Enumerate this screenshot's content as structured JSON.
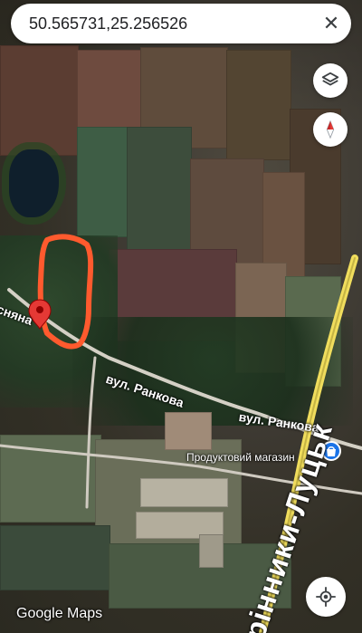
{
  "search": {
    "query": "50.565731,25.256526"
  },
  "map": {
    "road_label_primary": "вул. Ранкова",
    "road_label_secondary": "вул. Ранкова",
    "left_road_fragment": "сняна",
    "poi_label": "Продуктовий магазин",
    "major_road": "Хрінники-Луцьк",
    "attribution": "Google Maps"
  },
  "icons": {
    "close": "close-icon",
    "layers": "layers-icon",
    "compass": "compass-icon",
    "locate": "my-location-icon",
    "pin": "red-location-pin-icon",
    "store": "store-icon"
  }
}
